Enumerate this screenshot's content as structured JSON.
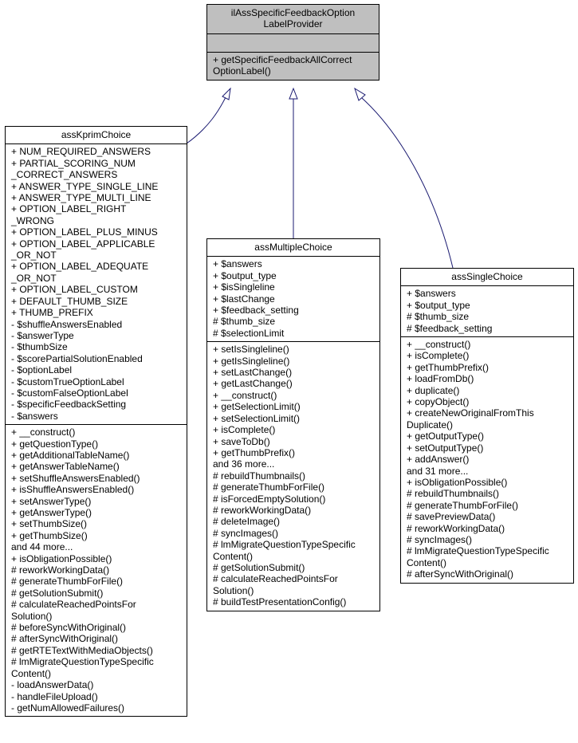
{
  "edge_color": "#191970",
  "base_fill": "#bfbfbf",
  "classes": [
    {
      "id": "base",
      "title": [
        "ilAssSpecificFeedbackOption",
        "LabelProvider"
      ],
      "attributes": [],
      "methods": [
        "+ getSpecificFeedbackAllCorrect",
        "OptionLabel()"
      ]
    },
    {
      "id": "kprim",
      "title": [
        "assKprimChoice"
      ],
      "attributes": [
        "+ NUM_REQUIRED_ANSWERS",
        "+ PARTIAL_SCORING_NUM",
        "_CORRECT_ANSWERS",
        "+ ANSWER_TYPE_SINGLE_LINE",
        "+ ANSWER_TYPE_MULTI_LINE",
        "+ OPTION_LABEL_RIGHT",
        "_WRONG",
        "+ OPTION_LABEL_PLUS_MINUS",
        "+ OPTION_LABEL_APPLICABLE",
        "_OR_NOT",
        "+ OPTION_LABEL_ADEQUATE",
        "_OR_NOT",
        "+ OPTION_LABEL_CUSTOM",
        "+ DEFAULT_THUMB_SIZE",
        "+ THUMB_PREFIX",
        "- $shuffleAnswersEnabled",
        "- $answerType",
        "- $thumbSize",
        "- $scorePartialSolutionEnabled",
        "- $optionLabel",
        "- $customTrueOptionLabel",
        "- $customFalseOptionLabel",
        "- $specificFeedbackSetting",
        "- $answers"
      ],
      "methods": [
        "+ __construct()",
        "+ getQuestionType()",
        "+ getAdditionalTableName()",
        "+ getAnswerTableName()",
        "+ setShuffleAnswersEnabled()",
        "+ isShuffleAnswersEnabled()",
        "+ setAnswerType()",
        "+ getAnswerType()",
        "+ setThumbSize()",
        "+ getThumbSize()",
        "and 44 more...",
        "+ isObligationPossible()",
        "# reworkWorkingData()",
        "# generateThumbForFile()",
        "# getSolutionSubmit()",
        "# calculateReachedPointsFor",
        "Solution()",
        "# beforeSyncWithOriginal()",
        "# afterSyncWithOriginal()",
        "# getRTETextWithMediaObjects()",
        "# lmMigrateQuestionTypeSpecific",
        "Content()",
        "- loadAnswerData()",
        "- handleFileUpload()",
        "- getNumAllowedFailures()"
      ]
    },
    {
      "id": "multiple",
      "title": [
        "assMultipleChoice"
      ],
      "attributes": [
        "+ $answers",
        "+ $output_type",
        "+ $isSingleline",
        "+ $lastChange",
        "+ $feedback_setting",
        "# $thumb_size",
        "# $selectionLimit"
      ],
      "methods": [
        "+ setIsSingleline()",
        "+ getIsSingleline()",
        "+ setLastChange()",
        "+ getLastChange()",
        "+ __construct()",
        "+ getSelectionLimit()",
        "+ setSelectionLimit()",
        "+ isComplete()",
        "+ saveToDb()",
        "+ getThumbPrefix()",
        "and 36 more...",
        "# rebuildThumbnails()",
        "# generateThumbForFile()",
        "# isForcedEmptySolution()",
        "# reworkWorkingData()",
        "# deleteImage()",
        "# syncImages()",
        "# lmMigrateQuestionTypeSpecific",
        "Content()",
        "# getSolutionSubmit()",
        "# calculateReachedPointsFor",
        "Solution()",
        "# buildTestPresentationConfig()"
      ]
    },
    {
      "id": "single",
      "title": [
        "assSingleChoice"
      ],
      "attributes": [
        "+ $answers",
        "+ $output_type",
        "# $thumb_size",
        "# $feedback_setting"
      ],
      "methods": [
        "+ __construct()",
        "+ isComplete()",
        "+ getThumbPrefix()",
        "+ loadFromDb()",
        "+ duplicate()",
        "+ copyObject()",
        "+ createNewOriginalFromThis",
        "Duplicate()",
        "+ getOutputType()",
        "+ setOutputType()",
        "+ addAnswer()",
        "and 31 more...",
        "+ isObligationPossible()",
        "# rebuildThumbnails()",
        "# generateThumbForFile()",
        "# savePreviewData()",
        "# reworkWorkingData()",
        "# syncImages()",
        "# lmMigrateQuestionTypeSpecific",
        "Content()",
        "# afterSyncWithOriginal()"
      ]
    }
  ]
}
